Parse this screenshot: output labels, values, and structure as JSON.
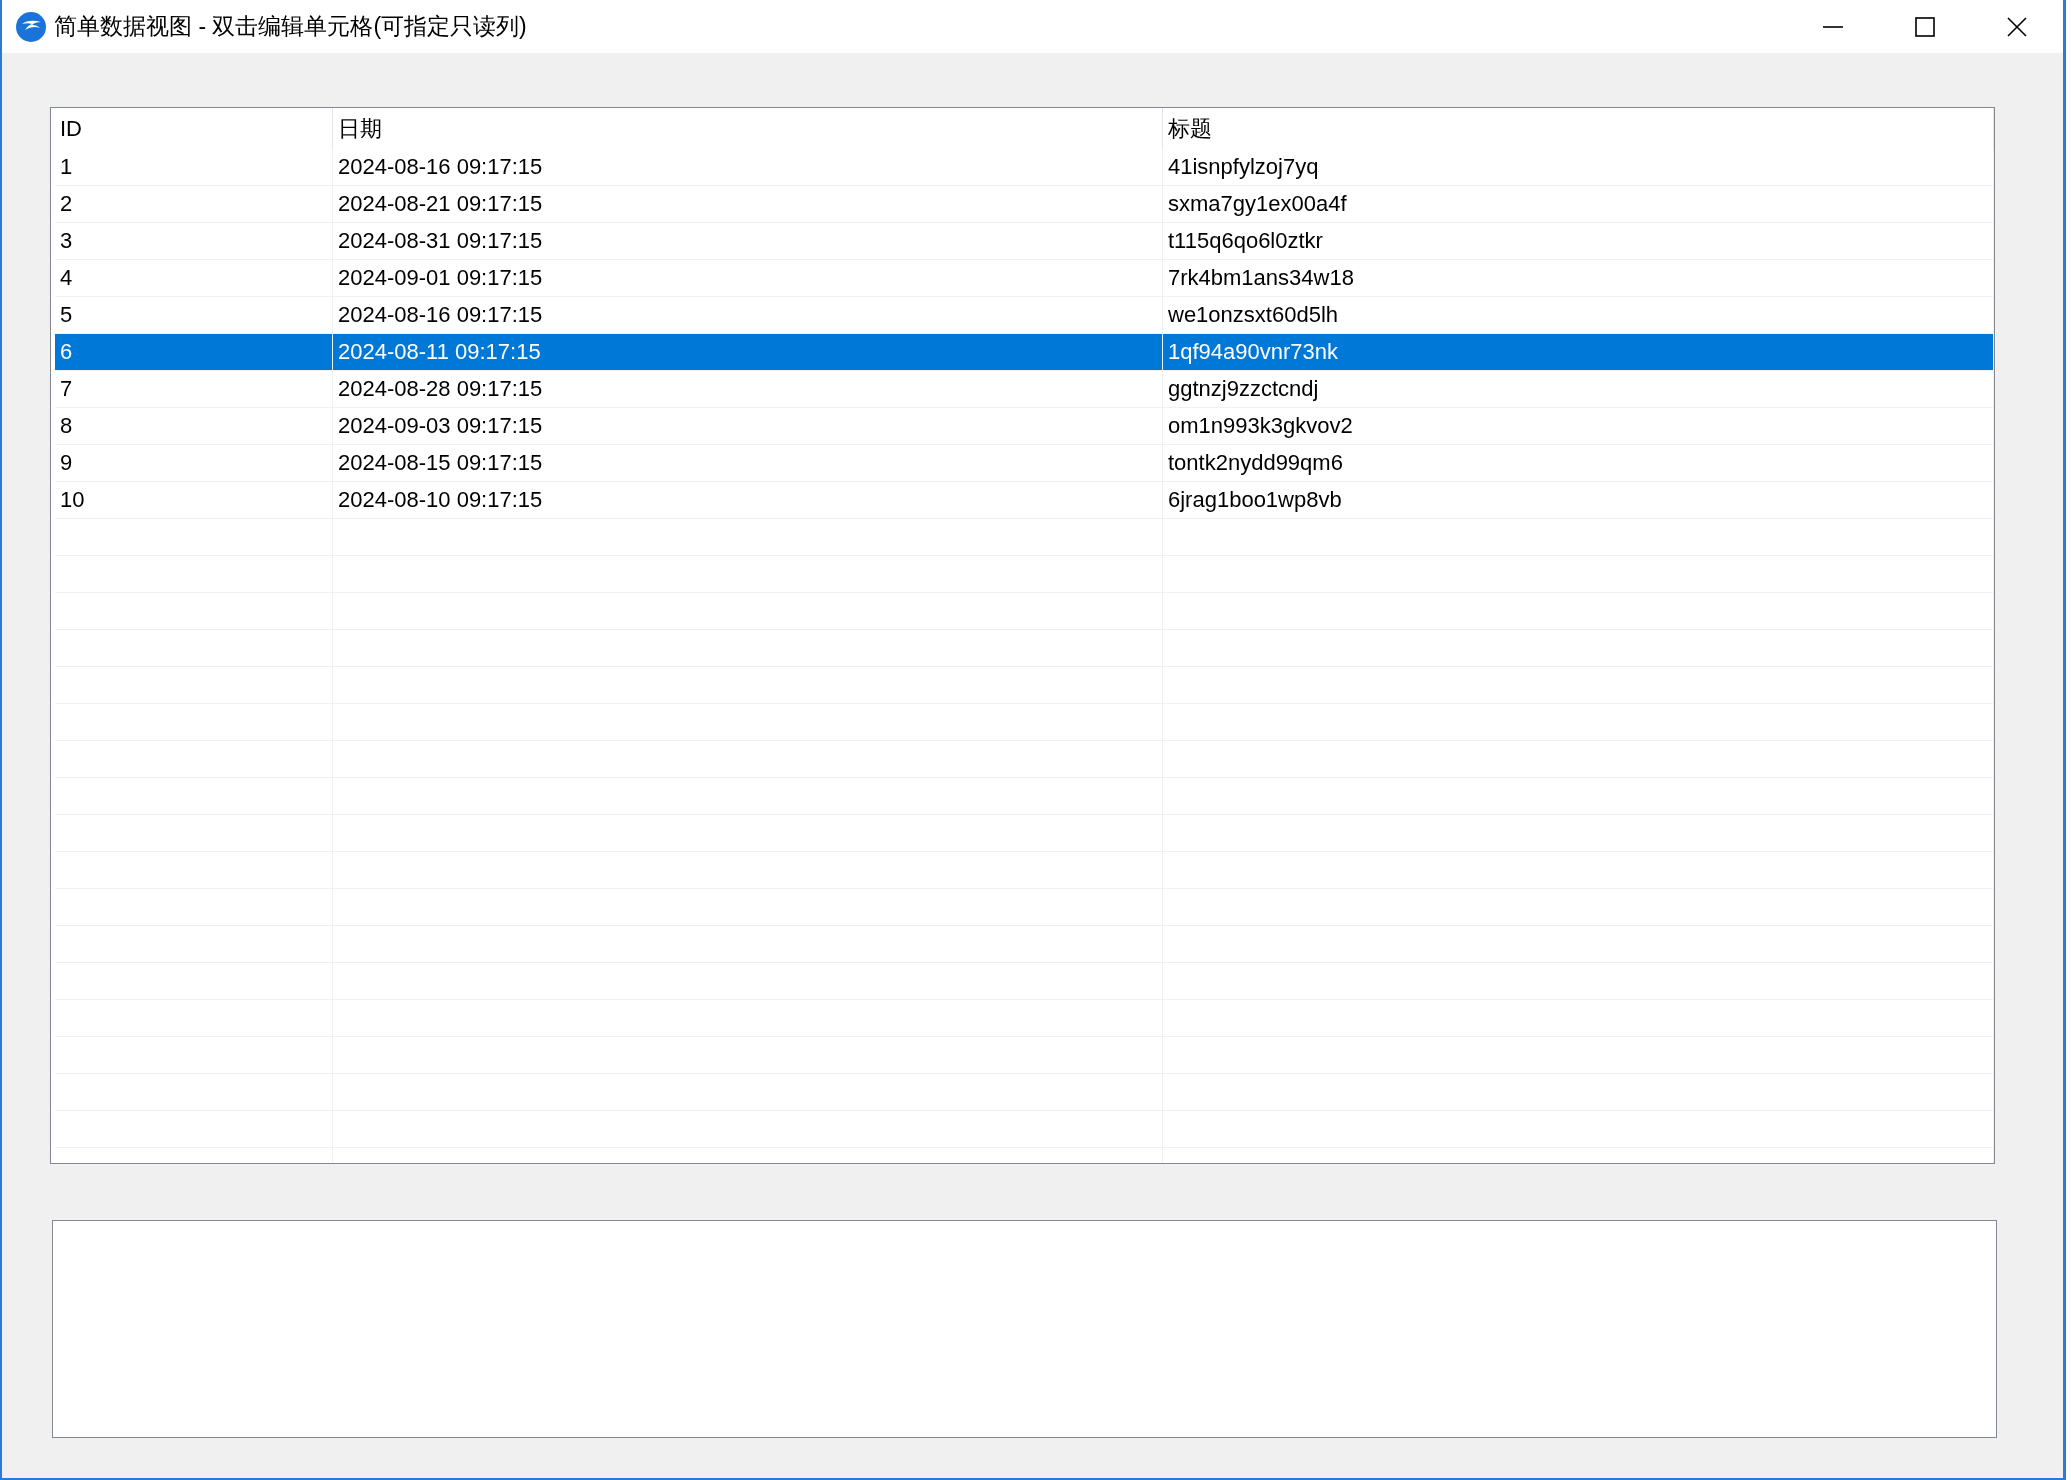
{
  "window": {
    "title": "简单数据视图 - 双击编辑单元格(可指定只读列)"
  },
  "table": {
    "columns": [
      "ID",
      "日期",
      "标题"
    ],
    "rows": [
      {
        "cells": [
          "1",
          "2024-08-16 09:17:15",
          "41isnpfylzoj7yq"
        ],
        "selected": false
      },
      {
        "cells": [
          "2",
          "2024-08-21 09:17:15",
          "sxma7gy1ex00a4f"
        ],
        "selected": false
      },
      {
        "cells": [
          "3",
          "2024-08-31 09:17:15",
          "t115q6qo6l0ztkr"
        ],
        "selected": false
      },
      {
        "cells": [
          "4",
          "2024-09-01 09:17:15",
          "7rk4bm1ans34w18"
        ],
        "selected": false
      },
      {
        "cells": [
          "5",
          "2024-08-16 09:17:15",
          "we1onzsxt60d5lh"
        ],
        "selected": false
      },
      {
        "cells": [
          "6",
          "2024-08-11 09:17:15",
          "1qf94a90vnr73nk"
        ],
        "selected": true
      },
      {
        "cells": [
          "7",
          "2024-08-28 09:17:15",
          "ggtnzj9zzctcndj"
        ],
        "selected": false
      },
      {
        "cells": [
          "8",
          "2024-09-03 09:17:15",
          "om1n993k3gkvov2"
        ],
        "selected": false
      },
      {
        "cells": [
          "9",
          "2024-08-15 09:17:15",
          "tontk2nydd99qm6"
        ],
        "selected": false
      },
      {
        "cells": [
          "10",
          "2024-08-10 09:17:15",
          "6jrag1boo1wp8vb"
        ],
        "selected": false
      }
    ]
  }
}
